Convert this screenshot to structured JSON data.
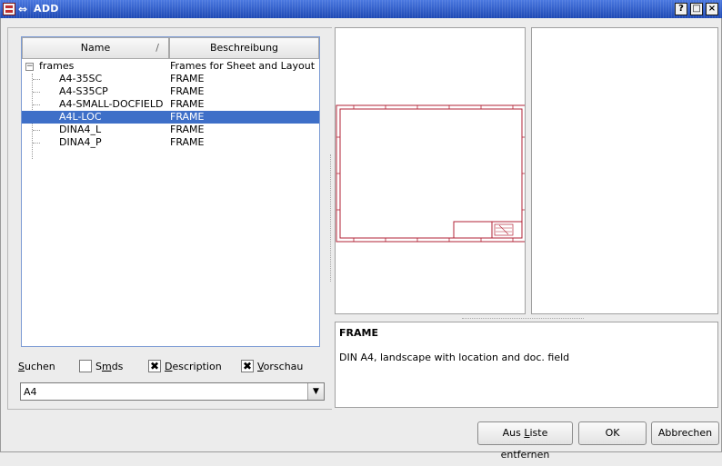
{
  "window": {
    "title": "ADD",
    "controls": [
      "?",
      "□",
      "×"
    ]
  },
  "list": {
    "columns": {
      "name": "Name",
      "sort_indicator": "/",
      "description": "Beschreibung"
    },
    "root": {
      "name": "frames",
      "description": "Frames for Sheet and Layout",
      "expander": "−"
    },
    "items": [
      {
        "name": "A4-35SC",
        "description": "FRAME"
      },
      {
        "name": "A4-S35CP",
        "description": "FRAME"
      },
      {
        "name": "A4-SMALL-DOCFIELD",
        "description": "FRAME"
      },
      {
        "name": "A4L-LOC",
        "description": "FRAME",
        "selected": true
      },
      {
        "name": "DINA4_L",
        "description": "FRAME"
      },
      {
        "name": "DINA4_P",
        "description": "FRAME"
      }
    ]
  },
  "search": {
    "label_first": "S",
    "label_rest": "uchen",
    "smds_a": "S",
    "smds_b": "m",
    "smds_c": "ds",
    "description_first": "D",
    "description_rest": "escription",
    "vorschau_first": "V",
    "vorschau_rest": "orschau",
    "check_mark": "✖",
    "smds_checked": false,
    "description_checked": true,
    "vorschau_checked": true,
    "value": "A4",
    "dropdown_arrow": "▼"
  },
  "preview": {
    "title": "FRAME",
    "text": "DIN A4, landscape with location and doc. field"
  },
  "buttons": {
    "remove_a": "Aus ",
    "remove_b": "L",
    "remove_c": "iste entfernen",
    "ok": "OK",
    "cancel": "Abbrechen"
  },
  "colors": {
    "titlebar": "#2a56c6",
    "selection": "#3e6fc8",
    "frame_drawing": "#b22234"
  }
}
